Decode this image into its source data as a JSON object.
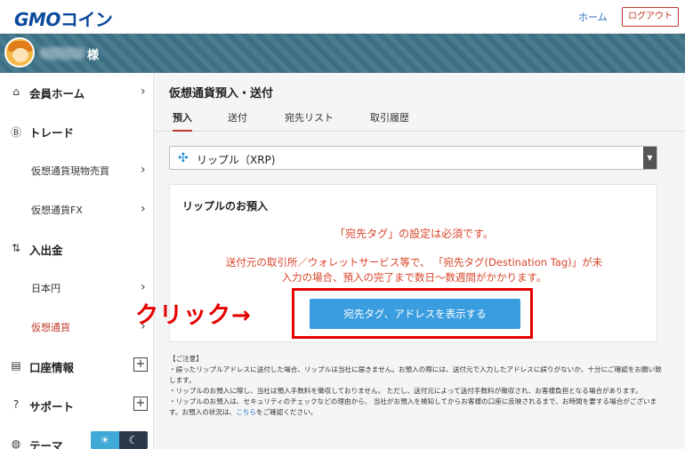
{
  "header": {
    "logo_gmo": "GMO",
    "logo_coin": "コイン",
    "home_label": "ホーム",
    "logout_label": "ログアウト"
  },
  "user": {
    "suffix": "様"
  },
  "sidebar": {
    "items": [
      {
        "label": "会員ホーム",
        "icon": "home-icon",
        "glyph": "⌂"
      },
      {
        "label": "トレード",
        "icon": "bitcoin-circle-icon",
        "glyph": "Ⓑ"
      },
      {
        "label": "仮想通貨現物売買"
      },
      {
        "label": "仮想通貨FX"
      },
      {
        "label": "入出金",
        "icon": "deposit-icon",
        "glyph": "⇅"
      },
      {
        "label": "日本円"
      },
      {
        "label": "仮想通貨"
      },
      {
        "label": "口座情報",
        "icon": "account-card-icon",
        "glyph": "▤"
      },
      {
        "label": "サポート",
        "icon": "help-icon",
        "glyph": "?"
      },
      {
        "label": "テーマ",
        "icon": "palette-icon",
        "glyph": "◍"
      }
    ],
    "chevron": "›",
    "plus": "+",
    "theme_sun": "☀",
    "theme_moon": "☾"
  },
  "main": {
    "title": "仮想通貨預入・送付",
    "tabs": [
      {
        "label": "預入"
      },
      {
        "label": "送付"
      },
      {
        "label": "宛先リスト"
      },
      {
        "label": "取引履歴"
      }
    ],
    "currency_select": {
      "value": "リップル（XRP)",
      "icon_glyph": "✣",
      "arrow": "▼"
    },
    "card": {
      "title": "リップルのお預入",
      "warning_1": "「宛先タグ」の設定は必須です。",
      "warning_2_line1": "送付元の取引所／ウォレットサービス等で、 「宛先タグ(Destination Tag)」が未",
      "warning_2_line2": "入力の場合、預入の完了まで数日～数週間がかかります。",
      "button_label": "宛先タグ、アドレスを表示する"
    },
    "annotation_label": "クリック→",
    "notes": {
      "title": "【ご注意】",
      "line1": "・誤ったリップルアドレスに送付した場合、リップルは当社に届きません。お預入の際には、送付元で入力したアドレスに誤りがないか、十分にご確認をお願い致します。",
      "line2": "・リップルのお預入に際し、当社は預入手数料を徴収しておりません。 ただし、送付元によって送付手数料が徴収され、お客様負担となる場合があります。",
      "line3a": "・リップルのお預入は、セキュリティのチェックなどの理由から、 当社がお預入を検知してからお客様の口座に反映されるまで、お時間を要する場合がございます。お預入の状況は、",
      "line3_link": "こちら",
      "line3b": "をご確認ください。"
    }
  }
}
